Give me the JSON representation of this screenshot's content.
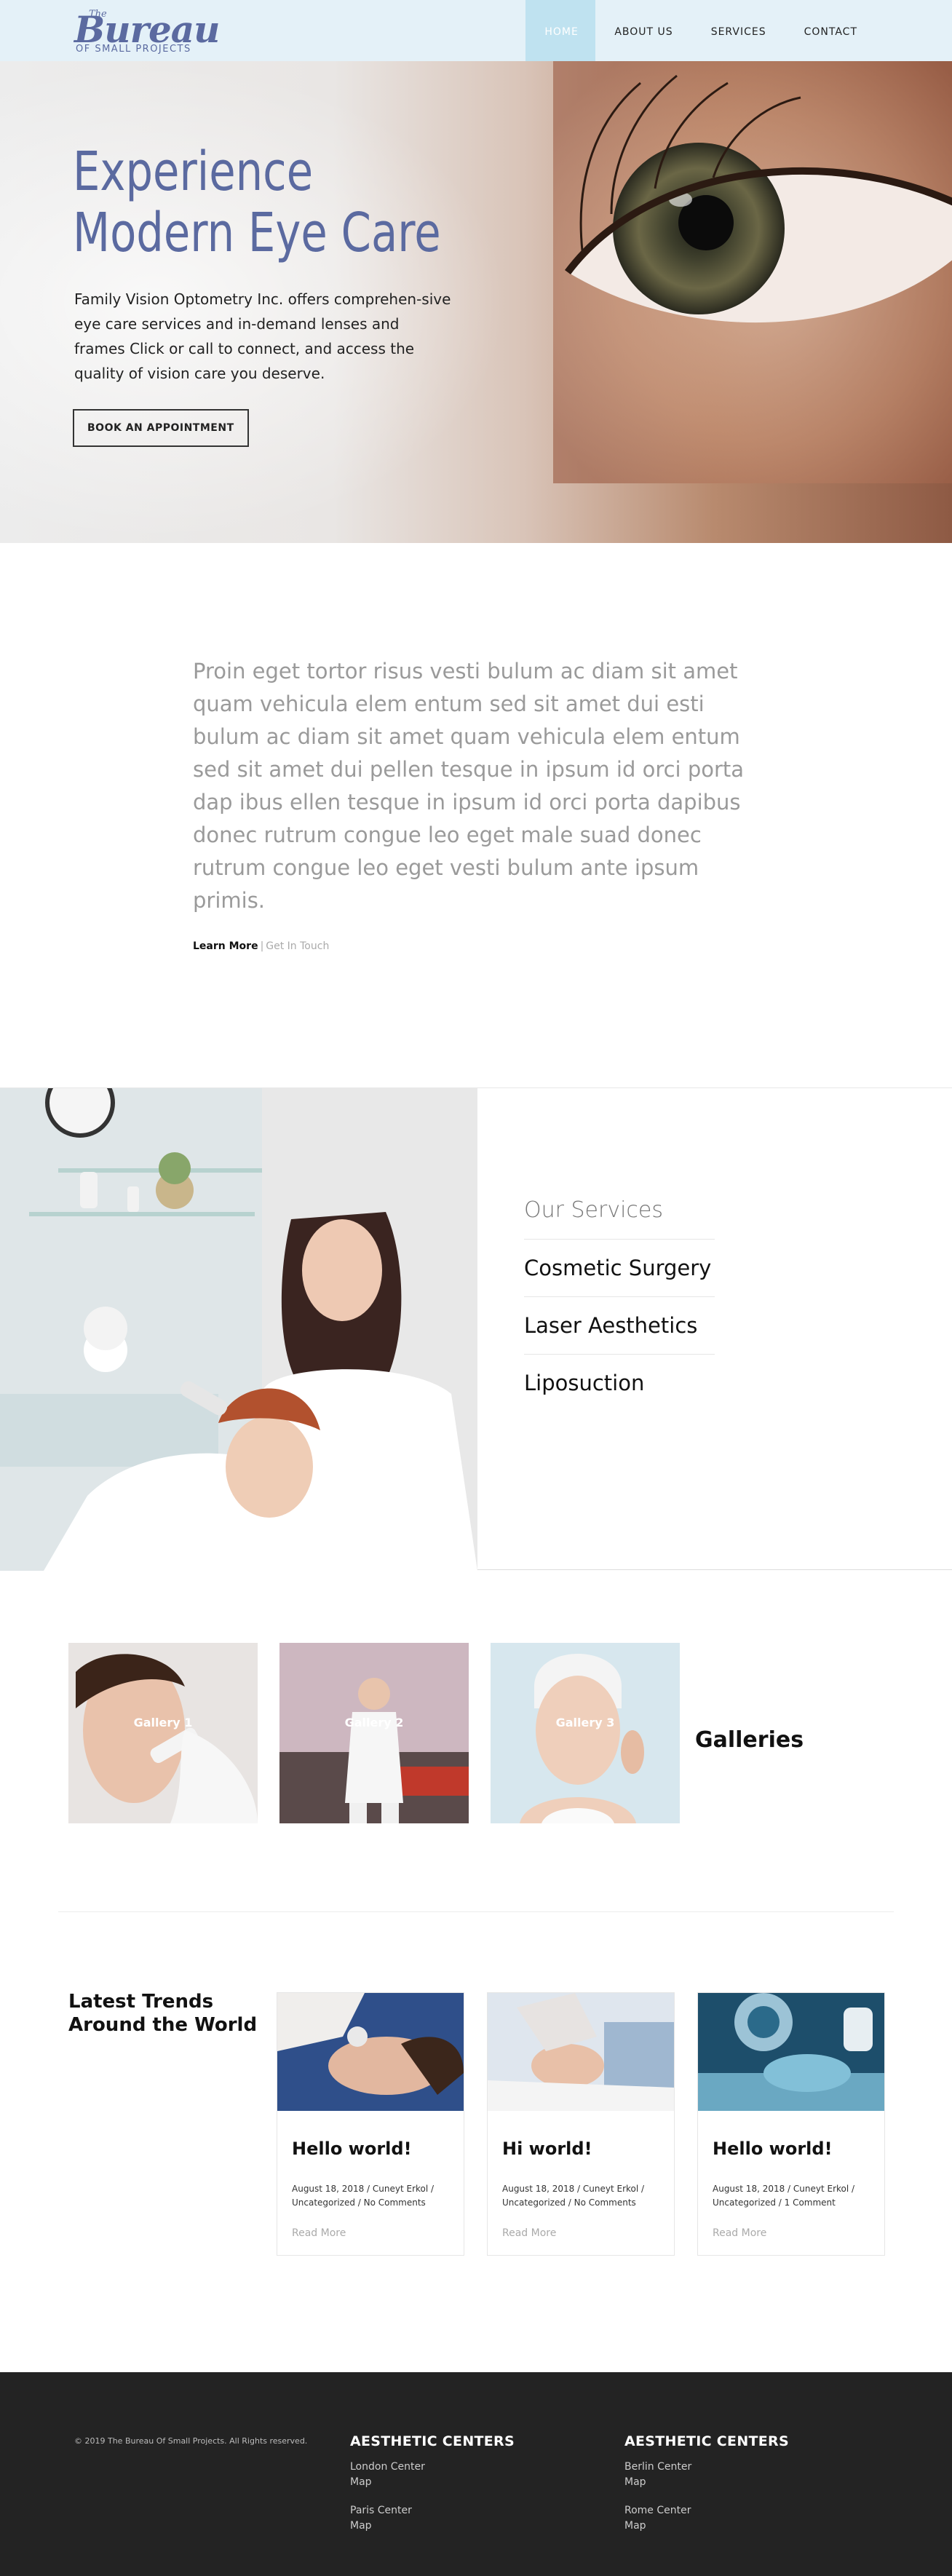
{
  "header": {
    "logo": {
      "the": "The",
      "name": "Bureau",
      "sub": "OF SMALL PROJECTS"
    },
    "nav": [
      "HOME",
      "ABOUT US",
      "SERVICES",
      "CONTACT"
    ]
  },
  "hero": {
    "title_line1": "Experience",
    "title_line2": "Modern Eye Care",
    "description": "Family Vision Optometry Inc. offers comprehen-sive eye care services and in-demand lenses and frames Click or call to connect, and access the quality of vision care you deserve.",
    "button": "BOOK AN APPOINTMENT"
  },
  "intro": {
    "text": "Proin eget tortor risus vesti bulum ac diam sit amet quam vehicula elem entum sed sit amet dui esti bulum ac diam sit amet quam vehicula elem entum sed sit amet dui pellen tesque in ipsum id orci porta dap ibus ellen tesque in ipsum id orci porta dapibus donec rutrum congue leo eget male suad donec rutrum congue leo eget vesti bulum ante ipsum primis.",
    "learn_more": "Learn More",
    "separator": "|",
    "get_in_touch": "Get In Touch"
  },
  "services": {
    "heading": "Our Services",
    "items": [
      "Cosmetic Surgery",
      "Laser Aesthetics",
      "Liposuction"
    ]
  },
  "galleries": {
    "title": "Galleries",
    "items": [
      "Gallery 1",
      "Gallery 2",
      "Gallery 3"
    ]
  },
  "trends": {
    "title": "Latest Trends Around the World",
    "posts": [
      {
        "title": "Hello world!",
        "meta": "August 18, 2018 / Cuneyt Erkol / Uncategorized / No Comments",
        "read_more": "Read More"
      },
      {
        "title": "Hi world!",
        "meta": "August 18, 2018 / Cuneyt Erkol / Uncategorized / No Comments",
        "read_more": "Read More"
      },
      {
        "title": "Hello world!",
        "meta": "August 18, 2018 / Cuneyt Erkol / Uncategorized / 1 Comment",
        "read_more": "Read More"
      }
    ]
  },
  "footer": {
    "copyright": "© 2019 The Bureau Of Small Projects. All Rights reserved.",
    "columns": [
      {
        "heading": "AESTHETIC CENTERS",
        "locations": [
          {
            "name": "London Center",
            "link": "Map"
          },
          {
            "name": "Paris Center",
            "link": "Map"
          }
        ]
      },
      {
        "heading": "AESTHETIC CENTERS",
        "locations": [
          {
            "name": "Berlin Center",
            "link": "Map"
          },
          {
            "name": "Rome Center",
            "link": "Map"
          }
        ]
      }
    ]
  },
  "colors": {
    "brand": "#5b6aa0",
    "header_bg": "#e4f1f8",
    "nav_active": "#bfe2f0",
    "footer_bg": "#232323"
  }
}
